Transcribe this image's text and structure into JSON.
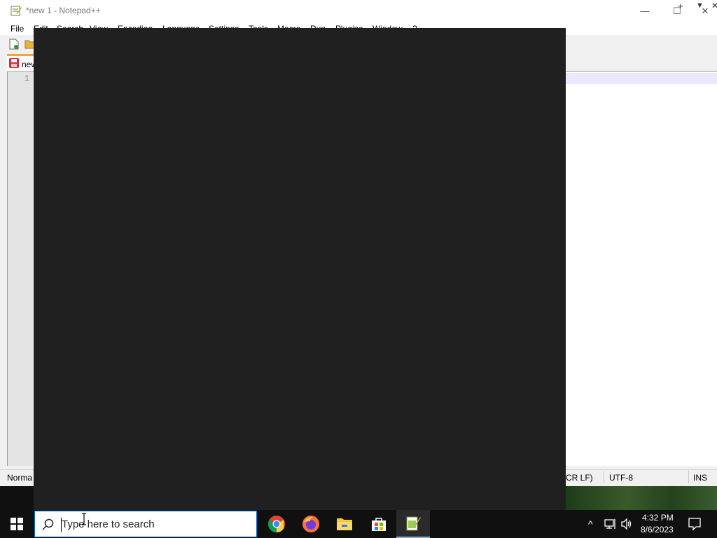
{
  "window": {
    "title": "*new 1 - Notepad++",
    "controls": {
      "minimize": "—",
      "maximize": "☐",
      "close": "✕"
    }
  },
  "menu": {
    "items": [
      "File",
      "Edit",
      "Search",
      "View",
      "Encoding",
      "Language",
      "Settings",
      "Tools",
      "Macro",
      "Run",
      "Plugins",
      "Window",
      "?"
    ],
    "right": {
      "plus": "+",
      "dropdown": "▼",
      "close": "✕"
    }
  },
  "tabs": [
    {
      "label": "new",
      "icon": "save-red-icon"
    }
  ],
  "editor": {
    "line_number": "1",
    "current_line_color": "#e8e8ff"
  },
  "statusbar": {
    "mode": "Norma",
    "eol": "(CR LF)",
    "encoding": "UTF-8",
    "ins": "INS"
  },
  "taskbar": {
    "search_placeholder": "Type here to search",
    "apps": [
      "chrome-icon",
      "firefox-icon",
      "file-explorer-icon",
      "store-icon",
      "notepadpp-icon"
    ],
    "clock_time": "4:32 PM",
    "clock_date": "8/6/2023"
  },
  "colors": {
    "overlay": "#202020",
    "taskbar": "#101010",
    "tab_accent": "#f4a43a",
    "search_border": "#0078d7"
  }
}
